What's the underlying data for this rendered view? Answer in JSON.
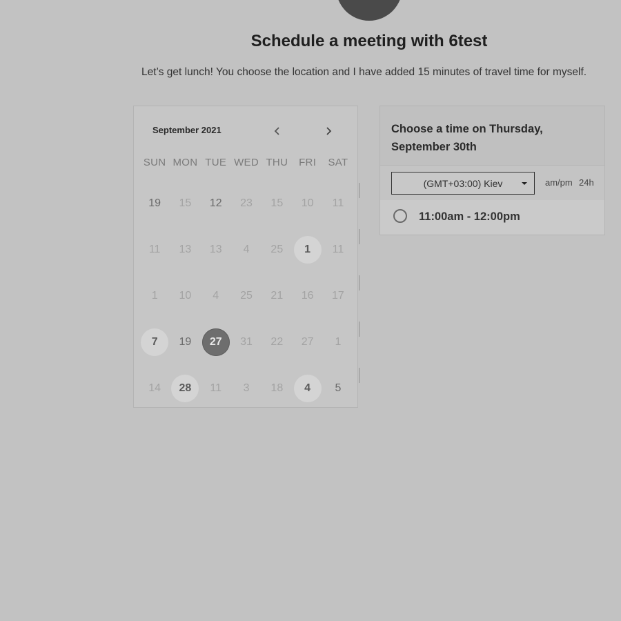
{
  "header": {
    "title": "Schedule a meeting with 6test",
    "subtitle": "Let’s get lunch! You choose the location and I have added 15 minutes of travel time for myself."
  },
  "calendar": {
    "month_label": "September 2021",
    "prev_icon": "chevron-left-icon",
    "next_icon": "chevron-right-icon",
    "weekdays": [
      "SUN",
      "MON",
      "TUE",
      "WED",
      "THU",
      "FRI",
      "SAT"
    ],
    "weeks": [
      [
        {
          "label": "19",
          "state": "dark"
        },
        {
          "label": "15",
          "state": "muted"
        },
        {
          "label": "12",
          "state": "dark"
        },
        {
          "label": "23",
          "state": "muted"
        },
        {
          "label": "15",
          "state": "muted"
        },
        {
          "label": "10",
          "state": "muted"
        },
        {
          "label": "11",
          "state": "muted"
        }
      ],
      [
        {
          "label": "11",
          "state": "muted"
        },
        {
          "label": "13",
          "state": "muted"
        },
        {
          "label": "13",
          "state": "muted"
        },
        {
          "label": "4",
          "state": "muted"
        },
        {
          "label": "25",
          "state": "muted"
        },
        {
          "label": "1",
          "state": "available"
        },
        {
          "label": "11",
          "state": "muted"
        }
      ],
      [
        {
          "label": "1",
          "state": "muted"
        },
        {
          "label": "10",
          "state": "muted"
        },
        {
          "label": "4",
          "state": "muted"
        },
        {
          "label": "25",
          "state": "muted"
        },
        {
          "label": "21",
          "state": "muted"
        },
        {
          "label": "16",
          "state": "muted"
        },
        {
          "label": "17",
          "state": "muted"
        }
      ],
      [
        {
          "label": "7",
          "state": "available"
        },
        {
          "label": "19",
          "state": "dark"
        },
        {
          "label": "27",
          "state": "selected"
        },
        {
          "label": "31",
          "state": "muted"
        },
        {
          "label": "22",
          "state": "muted"
        },
        {
          "label": "27",
          "state": "muted"
        },
        {
          "label": "1",
          "state": "muted"
        }
      ],
      [
        {
          "label": "14",
          "state": "muted"
        },
        {
          "label": "28",
          "state": "available"
        },
        {
          "label": "11",
          "state": "muted"
        },
        {
          "label": "3",
          "state": "muted"
        },
        {
          "label": "18",
          "state": "muted"
        },
        {
          "label": "4",
          "state": "available"
        },
        {
          "label": "5",
          "state": "dark"
        }
      ]
    ]
  },
  "times": {
    "heading_line1": "Choose a time on Thursday,",
    "heading_line2": "September 30th",
    "timezone_value": "(GMT+03:00) Kiev",
    "format_ampm": "am/pm",
    "format_24h": "24h",
    "slots": [
      {
        "label": "11:00am - 12:00pm"
      }
    ]
  },
  "colors": {
    "background": "#c2c2c2",
    "selected_day": "#6e6e6e",
    "available_day": "#d4d4d4"
  }
}
